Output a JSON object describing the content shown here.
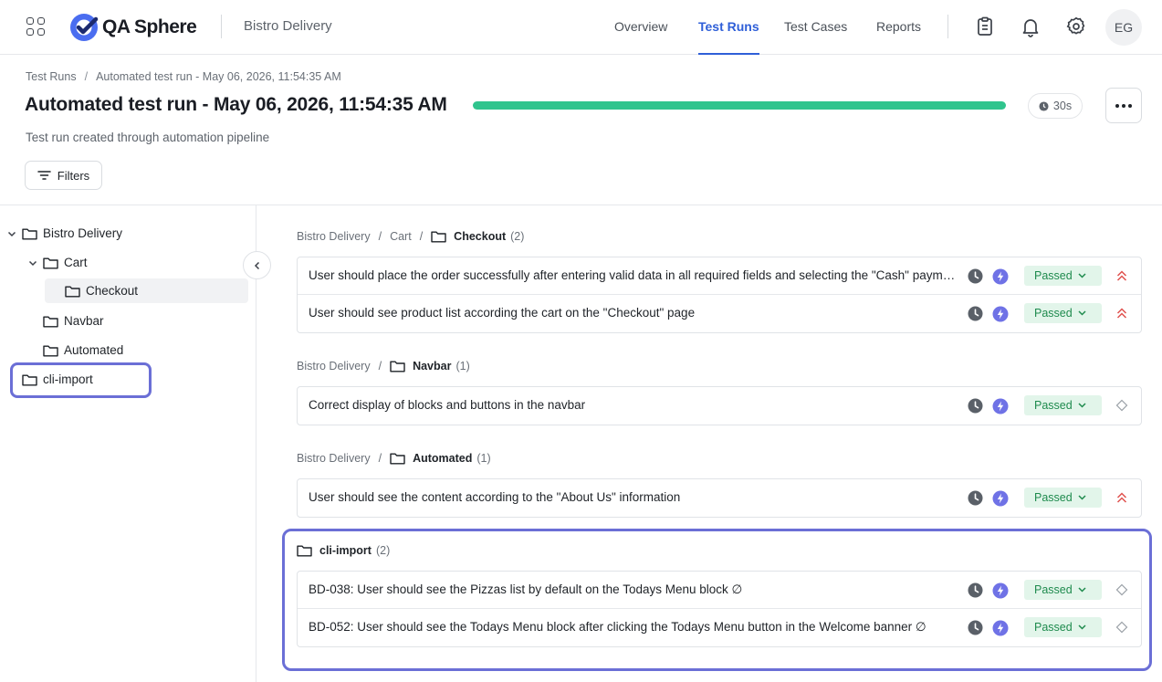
{
  "app": {
    "name": "QA Sphere",
    "project": "Bistro Delivery",
    "brand_color": "#2f5fd8"
  },
  "nav": {
    "overview": "Overview",
    "test_runs": "Test Runs",
    "test_cases": "Test Cases",
    "reports": "Reports",
    "active": "Test Runs"
  },
  "user": {
    "initials": "EG"
  },
  "header": {
    "breadcrumb_root": "Test Runs",
    "breadcrumb_current": "Automated test run - May 06, 2026, 11:54:35 AM",
    "title": "Automated test run - May 06, 2026, 11:54:35 AM",
    "subtitle": "Test run created through automation pipeline",
    "progress_percent": 100,
    "duration": "30s",
    "filters_label": "Filters"
  },
  "sidebar": {
    "items": [
      {
        "label": "Bistro Delivery",
        "level": 0,
        "expanded": true
      },
      {
        "label": "Cart",
        "level": 1,
        "expanded": true
      },
      {
        "label": "Checkout",
        "level": 2,
        "selected": true
      },
      {
        "label": "Navbar",
        "level": 1
      },
      {
        "label": "Automated",
        "level": 1
      },
      {
        "label": "cli-import",
        "level": 0,
        "highlighted": true
      }
    ]
  },
  "groups": [
    {
      "path": [
        "Bistro Delivery",
        "Cart"
      ],
      "folder": "Checkout",
      "count": "(2)",
      "rows": [
        {
          "title": "User should place the order successfully after entering valid data in all required fields and selecting the \"Cash\" payment method",
          "status": "Passed",
          "priority": "high"
        },
        {
          "title": "User should see product list according the cart on the \"Checkout\" page",
          "status": "Passed",
          "priority": "high"
        }
      ]
    },
    {
      "path": [
        "Bistro Delivery"
      ],
      "folder": "Navbar",
      "count": "(1)",
      "rows": [
        {
          "title": "Correct display of blocks and buttons in the navbar",
          "status": "Passed",
          "priority": "none"
        }
      ]
    },
    {
      "path": [
        "Bistro Delivery"
      ],
      "folder": "Automated",
      "count": "(1)",
      "rows": [
        {
          "title": "User should see the content according to the \"About Us\" information",
          "status": "Passed",
          "priority": "high"
        }
      ]
    },
    {
      "path": [],
      "folder": "cli-import",
      "count": "(2)",
      "rows": [
        {
          "title": "BD-038: User should see the Pizzas list by default on the Todays Menu block ∅",
          "status": "Passed",
          "priority": "none"
        },
        {
          "title": "BD-052: User should see the Todays Menu block after clicking the Todays Menu button in the Welcome banner ∅",
          "status": "Passed",
          "priority": "none"
        }
      ]
    }
  ],
  "colors": {
    "passed_bg": "#e2f5ea",
    "passed_text": "#1f8b4e",
    "priority_high": "#e0524f",
    "automation_bolt": "#6f72e6",
    "highlight": "#6b6fd6"
  },
  "icons": {
    "apps": "apps-grid-icon",
    "clipboard": "clipboard-icon",
    "bell": "bell-icon",
    "settings": "gear-icon",
    "folder": "folder-icon",
    "clock": "clock-icon",
    "automation": "lightning-icon",
    "priority_high": "double-chevron-up-icon",
    "priority_none": "diamond-icon"
  }
}
